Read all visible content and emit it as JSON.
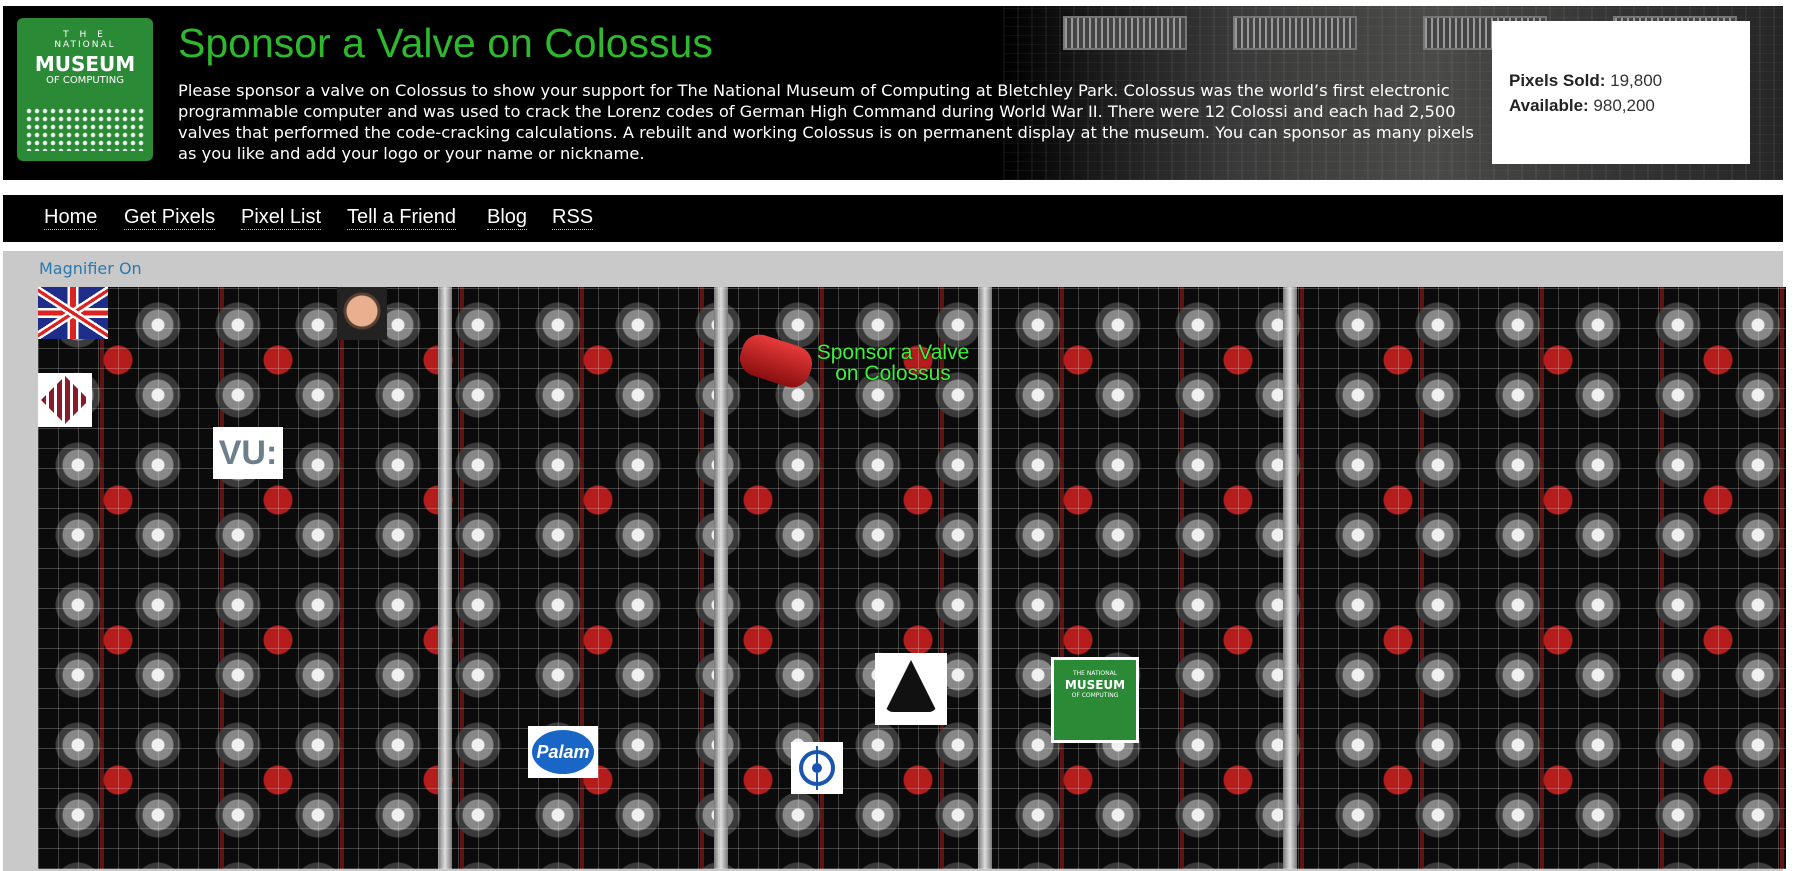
{
  "header": {
    "logo": {
      "line1": "T H E",
      "line2": "NATIONAL",
      "line3": "MUSEUM",
      "line4": "OF COMPUTING"
    },
    "title": "Sponsor a Valve on Colossus",
    "intro": "Please sponsor a valve on Colossus to show your support for The National Museum of Computing at Bletchley Park. Colossus was the world’s first electronic programmable computer and was used to crack the Lorenz codes of German High Command during World War II. There were 12 Colossi and each had 2,500 valves that performed the code-cracking calculations. A rebuilt and working Colossus is on permanent display at the museum. You can sponsor as many pixels as you like and add your logo or your name or nickname.",
    "stats": {
      "sold_label": "Pixels Sold:",
      "sold_value": "19,800",
      "available_label": "Available:",
      "available_value": "980,200"
    }
  },
  "nav": {
    "items": [
      {
        "label": "Home"
      },
      {
        "label": "Get Pixels"
      },
      {
        "label": "Pixel List"
      },
      {
        "label": "Tell a Friend"
      },
      {
        "label": "Blog"
      },
      {
        "label": "RSS"
      }
    ]
  },
  "board": {
    "magnifier_label": "Magnifier On",
    "banner_line1": "Sponsor a Valve",
    "banner_line2": "on Colossus",
    "ads": {
      "vu": "VU:",
      "palam": "Palam",
      "museum_top": "THE NATIONAL",
      "museum_mid": "MUSEUM",
      "museum_bot": "OF COMPUTING"
    }
  },
  "colors": {
    "title_green": "#2db82d",
    "link_blue": "#2a79b0",
    "banner_green": "#3cf23c"
  }
}
